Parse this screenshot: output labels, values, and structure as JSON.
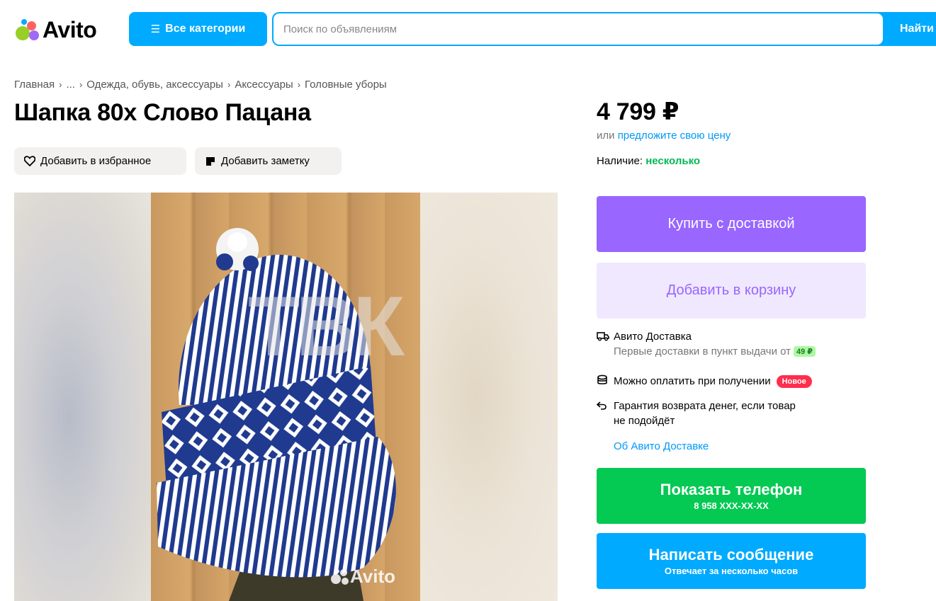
{
  "header": {
    "logo_text": "Avito",
    "categories_button": "Все категории",
    "search_placeholder": "Поиск по объявлениям",
    "search_button": "Найти"
  },
  "breadcrumb": [
    "Главная",
    "...",
    "Одежда, обувь, аксессуары",
    "Аксессуары",
    "Головные уборы"
  ],
  "listing": {
    "title": "Шапка 80х Слово Пацана",
    "favorite_label": "Добавить в избранное",
    "note_label": "Добавить заметку",
    "photo_watermark": "ТВК",
    "photo_logo": "Avito"
  },
  "price": {
    "amount": "4 799 ₽",
    "offer_prefix": "или",
    "offer_link": "предложите свою цену",
    "availability_label": "Наличие:",
    "availability_value": "несколько"
  },
  "actions": {
    "buy_label": "Купить с доставкой",
    "cart_label": "Добавить в корзину",
    "phone_label": "Показать телефон",
    "phone_number": "8 958 XXX-XX-XX",
    "message_label": "Написать сообщение",
    "message_sub": "Отвечает за несколько часов"
  },
  "delivery": {
    "title": "Авито Доставка",
    "subtitle": "Первые доставки в пункт выдачи от",
    "price_tag": "49 ₽",
    "pay_on_receipt": "Можно оплатить при получении",
    "new_badge": "Новое",
    "guarantee_line1": "Гарантия возврата денег, если товар",
    "guarantee_line2": "не подойдёт",
    "about_link": "Об Авито Доставке"
  },
  "colors": {
    "brand_blue": "#00aaff",
    "purple": "#9966ff",
    "green": "#04c953",
    "link": "#0099f7",
    "availability_green": "#02b855",
    "badge_red": "#ff2e4c"
  }
}
